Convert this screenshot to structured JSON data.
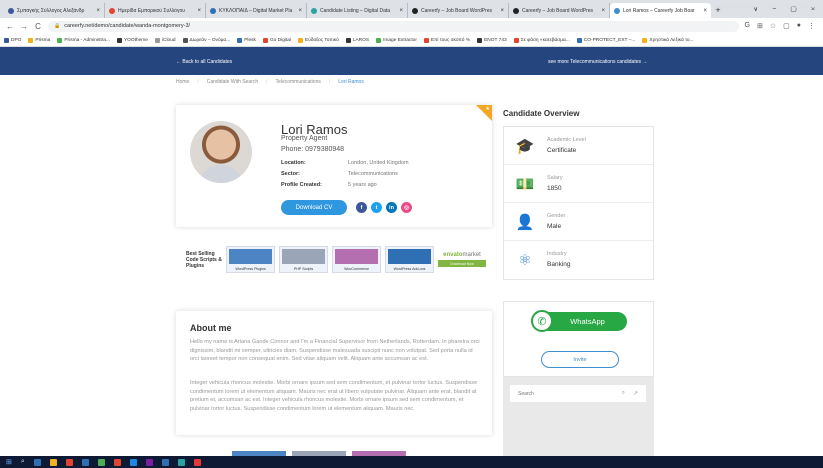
{
  "browser": {
    "tabs": [
      {
        "title": "Σμπαγκής Σύλλογος Αλεξάνδρ",
        "color": "#3b5998",
        "active": false
      },
      {
        "title": "Ημερίδα Εμπορικού Συλλόγου",
        "color": "#e0452f",
        "active": false
      },
      {
        "title": "ΚΥΚΛΟΠΑΙΔ – Digital Market Pla",
        "color": "#2f6fb3",
        "active": false
      },
      {
        "title": "Candidate Listing – Digital Data",
        "color": "#2aa3a3",
        "active": false
      },
      {
        "title": "Careerfy – Job Board WordPres",
        "color": "#222222",
        "active": false
      },
      {
        "title": "Careerfy – Job Board WordPres",
        "color": "#222222",
        "active": false
      },
      {
        "title": "Lori Ramos – Careerfy Job Boar",
        "color": "#3e8ed0",
        "active": true
      }
    ],
    "tab_close": "×",
    "new_tab": "+",
    "window_controls": [
      "∨",
      "−",
      "▢",
      "×"
    ],
    "nav": {
      "back": "←",
      "forward": "→",
      "reload": "C"
    },
    "url": "careerfy.net/demo/candidate/wanda-montgomery-3/",
    "lock": "🔒",
    "addr_icons": [
      "G",
      "⊞",
      "☆",
      "▢",
      "●",
      "⋮"
    ],
    "bookmarks": [
      {
        "label": "DPO",
        "color": "#3b5998"
      },
      {
        "label": "Prisma",
        "color": "#f2b01e"
      },
      {
        "label": "Prisma - Administra...",
        "color": "#4caf50"
      },
      {
        "label": "YOOtheme",
        "color": "#333333"
      },
      {
        "label": "iCloud",
        "color": "#999999"
      },
      {
        "label": "Δωρεάν – Ονόμα...",
        "color": "#555555"
      },
      {
        "label": "Plesk",
        "color": "#2f6fb3"
      },
      {
        "label": "Go Digital",
        "color": "#e0452f"
      },
      {
        "label": "Εύδοξος Τοπικό",
        "color": "#f2b01e"
      },
      {
        "label": "LAROS",
        "color": "#333333"
      },
      {
        "label": "Image Extractor",
        "color": "#4caf50"
      },
      {
        "label": "Επί τους σκοπό %",
        "color": "#e0452f"
      },
      {
        "label": "ENOT 743",
        "color": "#333333"
      },
      {
        "label": "Σε φάση «κατεβάσμα...",
        "color": "#e0452f"
      },
      {
        "label": "CO-PROTECT_EXT –...",
        "color": "#2f6fb3"
      },
      {
        "label": "Χρηστικά Λεξικά το...",
        "color": "#f2b01e"
      }
    ]
  },
  "header": {
    "back_link": "← Back to all Candidates",
    "more_link": "see more Telecommunications candidates →"
  },
  "breadcrumb": {
    "items": [
      "Home",
      "Candidate With Search",
      "Telecommunications",
      "Lori Ramos"
    ],
    "separator": "/"
  },
  "candidate": {
    "name": "Lori Ramos",
    "title": "Property Agent",
    "phone": "Phone: 0979380948",
    "details": [
      {
        "label": "Location:",
        "value": "London, United Kingdom"
      },
      {
        "label": "Sector:",
        "value": "Telecommunications"
      },
      {
        "label": "Profile Created:",
        "value": "5 years ago"
      }
    ],
    "download_label": "Download CV",
    "featured_icon": "★",
    "social": [
      {
        "name": "facebook",
        "glyph": "f",
        "color": "#3b5998"
      },
      {
        "name": "twitter",
        "glyph": "t",
        "color": "#1da1f2"
      },
      {
        "name": "linkedin",
        "glyph": "in",
        "color": "#0077b5"
      },
      {
        "name": "dribbble",
        "glyph": "◎",
        "color": "#ea4c89"
      }
    ]
  },
  "banner": {
    "text": "Best Selling Code Scripts & Plugins",
    "items": [
      "WordPress Plugins",
      "PHP Scripts",
      "WooCommerce",
      "WordPress Add-ons"
    ],
    "envato_logo_a": "envato",
    "envato_logo_b": "market",
    "envato_button": "Download Now"
  },
  "about": {
    "title": "About me",
    "p1": "Hello my name is Ariana Gande Connor and I'm a Financial Supervisor from Netherlands, Rotterdam. In pharetra orci dignissim, blandit mi semper, ultricies diam. Suspendisse malesuada suscipit nunc non volutpat. Sed porta nulla id orci laoreet tempor non consequat enim. Sed vitae aliquam velit. Aliquam ante accumsan ac est.",
    "p2": "Integer vehicula rhoncus molestie. Morbi ornare ipsum sed sem condimentum, et pulvinar tortor luctus. Suspendisse condimentum lorem ut elementum aliquam. Mauris nec erat ut libero vulputate pulvinar. Aliquam ante erat, blandit at pretium et, accumsan ac est. Integer vehicula rhoncus molestie. Morbi ornare ipsum sed sem condimentum, et pulvinar tortor luctus. Suspendisse condimentum lorem ut elementum aliquam. Mauris nec."
  },
  "overview": {
    "title": "Candidate Overview",
    "items": [
      {
        "label": "Academic Level",
        "value": "Certificate",
        "icon": "graduation-cap-icon",
        "glyph": "🎓"
      },
      {
        "label": "Salary",
        "value": "1850",
        "icon": "money-icon",
        "glyph": "💵"
      },
      {
        "label": "Gender",
        "value": "Male",
        "icon": "user-icon",
        "glyph": "👤"
      },
      {
        "label": "Industry",
        "value": "Banking",
        "icon": "network-icon",
        "glyph": "⚛"
      }
    ]
  },
  "contact": {
    "whatsapp_label": "WhatsApp",
    "whatsapp_glyph": "✆",
    "invite_label": "Invite"
  },
  "search": {
    "placeholder": "Search",
    "search_glyph": "⌕",
    "share_glyph": "↗"
  },
  "taskbar": {
    "start_glyph": "⊞",
    "search_glyph": "⌕",
    "app_colors": [
      "#2f6fb3",
      "#f2b01e",
      "#e0452f",
      "#2f6fb3",
      "#4caf50",
      "#e0452f",
      "#1e88e5",
      "#7b1fa2",
      "#2f6fb3",
      "#2aa3a3",
      "#e53935"
    ],
    "weather": "16°C  Εντονος νεφώσ...",
    "lang": "ENG",
    "time": "3:24 μμ",
    "tray_glyph": "∧ ⊡ ☷"
  }
}
